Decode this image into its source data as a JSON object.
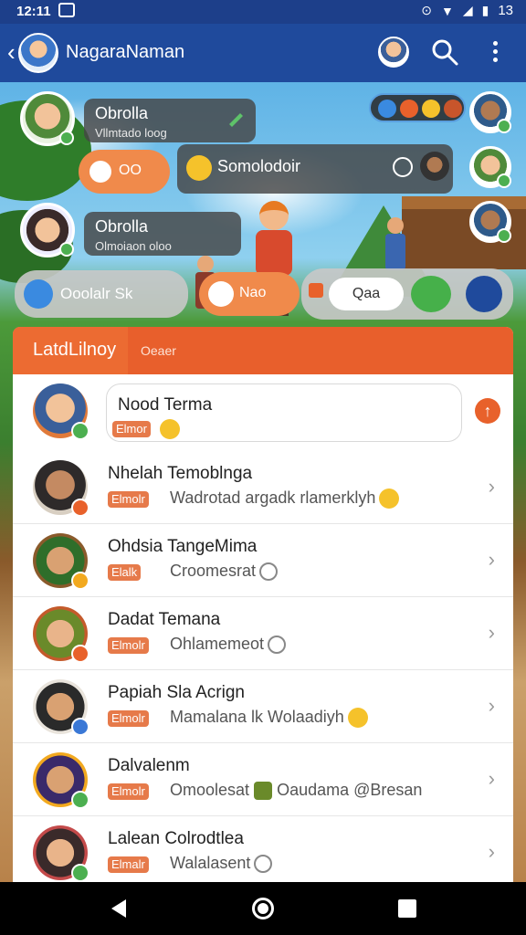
{
  "status_bar": {
    "time": "12:11",
    "battery": "13"
  },
  "app_bar": {
    "title": "NagaraNaman"
  },
  "chat_bubbles": [
    {
      "name": "Obrolla",
      "sub": "Vllmtado loog"
    },
    {
      "name": "Somolodoir"
    },
    {
      "name": "Obrolla",
      "sub": "Olmoiaon oloo"
    }
  ],
  "pills": {
    "orange_pill": "OO",
    "grey_pill": "Ooolalr Sk",
    "orange_pill_2": "Nao",
    "white_pill": "Qaa"
  },
  "tabs": {
    "active": "LatdLilnoy",
    "other": "Oeaer"
  },
  "contacts": [
    {
      "name": "Nood Terma",
      "tag": "Elmor",
      "message": "",
      "emoji": true,
      "badge_color": "#4caf50"
    },
    {
      "name": "Nhelah Temoblnga",
      "tag": "Elmolr",
      "message": "Wadrotad argadk rlamerklyh",
      "emoji": true,
      "badge_color": "#e8612b"
    },
    {
      "name": "Ohdsia TangeMima",
      "tag": "Elalk",
      "message": "Croomesrat",
      "emoji": false,
      "badge_color": "#f2a91f"
    },
    {
      "name": "Dadat Temana",
      "tag": "Elmolr",
      "message": "Ohlamemeot",
      "emoji": false,
      "badge_color": "#e8612b"
    },
    {
      "name": "Papiah Sla Acrign",
      "tag": "Elmolr",
      "message": "Mamalana lk Wolaadiyh",
      "emoji": true,
      "badge_color": "#3a78d6"
    },
    {
      "name": "Dalvalenm",
      "tag": "Elmolr",
      "message": "Omoolesat",
      "extra": "Oaudama @Bresan",
      "emoji": false,
      "badge_color": "#4caf50"
    },
    {
      "name": "Lalean Colrodtlea",
      "tag": "Elmalr",
      "message": "Walalasent",
      "emoji": false,
      "badge_color": "#4caf50"
    }
  ]
}
